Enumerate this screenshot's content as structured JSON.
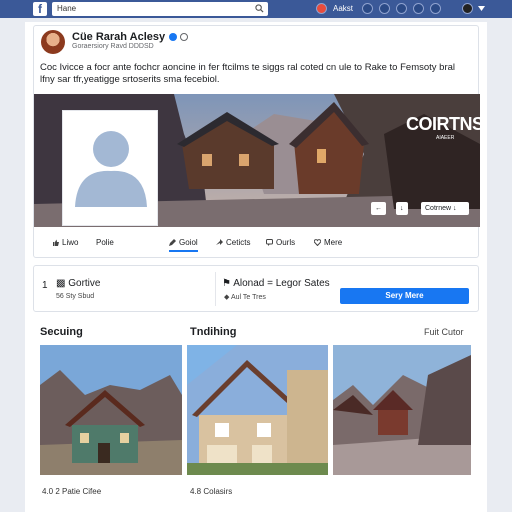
{
  "topbar": {
    "logo": "f",
    "search_value": "Hane",
    "label": "Aakst"
  },
  "post": {
    "author": "Cüe Rarah Aclesy",
    "subtitle": "Goraersiory Ravd DDDSD",
    "text": "Coc Ivicce a focr ante fochcr aoncine in fer ftcilms te siggs ral coted cn ule to Rake to Femsoty bral lfny sar tfr,yeatigge srtoserits sma fecebiol."
  },
  "cover": {
    "brand": "COIRTNS",
    "brand_sub": "AIAEER",
    "buttons": [
      "←",
      "↓",
      "Cotrnew ↓"
    ]
  },
  "tabs": [
    {
      "label": "Liwo",
      "icon": "thumbs-up-icon"
    },
    {
      "label": "Polie",
      "icon": ""
    },
    {
      "label": "Goiol",
      "icon": "edit-icon"
    },
    {
      "label": "Ceticts",
      "icon": "share-icon"
    },
    {
      "label": "Ourls",
      "icon": "comment-icon"
    },
    {
      "label": "Mere",
      "icon": "heart-icon"
    }
  ],
  "info": {
    "count": "1",
    "title_a": "Gortive",
    "sub_a": "56 Sty Sbud",
    "title_b": "Alonad = Legor Sates",
    "sub_b": "Aul Te Tres",
    "cta": "Sery Mere"
  },
  "gallery": {
    "heading_a": "Secuing",
    "heading_b": "Tndihing",
    "more": "Fuit Cutor",
    "captions": [
      "4.0 2 Patie Cifee",
      "4.8 Colasirs",
      ""
    ]
  },
  "colors": {
    "brand": "#3b5998",
    "accent": "#1877f2"
  }
}
